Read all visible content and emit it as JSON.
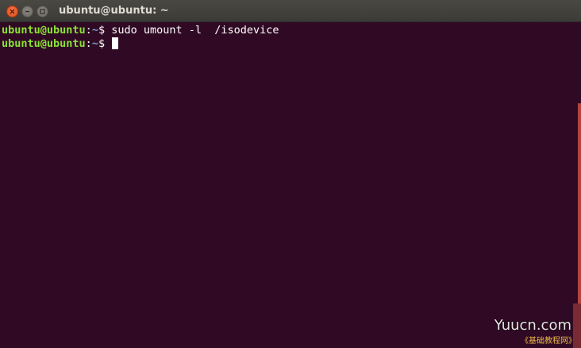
{
  "window": {
    "title": "ubuntu@ubuntu: ~"
  },
  "terminal": {
    "lines": [
      {
        "user_host": "ubuntu@ubuntu",
        "colon": ":",
        "path": "~",
        "sign": "$ ",
        "command": "sudo umount -l  /isodevice"
      },
      {
        "user_host": "ubuntu@ubuntu",
        "colon": ":",
        "path": "~",
        "sign": "$ ",
        "command": ""
      }
    ]
  },
  "watermark": {
    "main": "Yuucn.com",
    "sub": "《基础教程网》"
  },
  "colors": {
    "background": "#300a24",
    "prompt_user": "#8ae234",
    "prompt_path": "#729fcf",
    "close_button": "#df4a16"
  },
  "icons": {
    "close": "close-icon",
    "minimize": "minimize-icon",
    "maximize": "maximize-icon"
  }
}
